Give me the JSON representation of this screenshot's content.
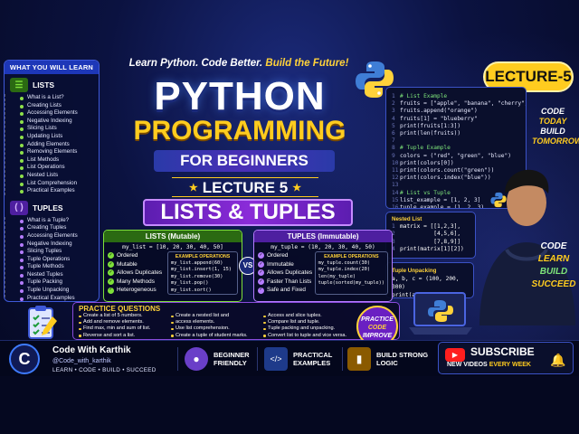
{
  "header": {
    "tagline_white": "Learn Python. Code Better. ",
    "tagline_yellow": "Build the Future!",
    "title_line1": "PYTHON",
    "title_line2": "PROGRAMMING",
    "subtitle": "FOR BEGINNERS",
    "lecture_line": "LECTURE 5",
    "topic": "LISTS & TUPLES",
    "lecture_badge": "LECTURE-5"
  },
  "sidebar": {
    "heading": "WHAT YOU WILL LEARN",
    "lists": {
      "title": "LISTS",
      "items": [
        "What is a List?",
        "Creating Lists",
        "Accessing Elements",
        "Negative Indexing",
        "Slicing Lists",
        "Updating Lists",
        "Adding Elements",
        "Removing Elements",
        "List Methods",
        "List Operations",
        "Nested Lists",
        "List Comprehension",
        "Practical Examples"
      ]
    },
    "tuples": {
      "title": "TUPLES",
      "items": [
        "What is a Tuple?",
        "Creating Tuples",
        "Accessing Elements",
        "Negative Indexing",
        "Slicing Tuples",
        "Tuple Operations",
        "Tuple Methods",
        "Nested Tuples",
        "Tuple Packing",
        "Tuple Unpacking",
        "Practical Examples"
      ]
    }
  },
  "code_main": [
    {
      "n": "1",
      "t": "# List Example",
      "c": "cmt"
    },
    {
      "n": "2",
      "t": "fruits = [\"apple\", \"banana\", \"cherry\"]",
      "c": ""
    },
    {
      "n": "3",
      "t": "fruits.append(\"orange\")",
      "c": ""
    },
    {
      "n": "4",
      "t": "fruits[1] = \"blueberry\"",
      "c": ""
    },
    {
      "n": "5",
      "t": "print(fruits[1:3])",
      "c": ""
    },
    {
      "n": "6",
      "t": "print(len(fruits))",
      "c": ""
    },
    {
      "n": "7",
      "t": "",
      "c": ""
    },
    {
      "n": "8",
      "t": "# Tuple Example",
      "c": "cmt"
    },
    {
      "n": "9",
      "t": "colors = (\"red\", \"green\", \"blue\")",
      "c": ""
    },
    {
      "n": "10",
      "t": "print(colors[0])",
      "c": ""
    },
    {
      "n": "11",
      "t": "print(colors.count(\"green\"))",
      "c": ""
    },
    {
      "n": "12",
      "t": "print(colors.index(\"blue\"))",
      "c": ""
    },
    {
      "n": "13",
      "t": "",
      "c": ""
    },
    {
      "n": "14",
      "t": "# List vs Tuple",
      "c": "cmt"
    },
    {
      "n": "15",
      "t": "list_example = [1, 2, 3]",
      "c": ""
    },
    {
      "n": "16",
      "t": "tuple_example = (1, 2, 3)",
      "c": ""
    }
  ],
  "code_nested": {
    "title": "Nested List",
    "lines": [
      {
        "n": "1",
        "t": "matrix = [[1,2,3],"
      },
      {
        "n": "2",
        "t": "          [4,5,6],"
      },
      {
        "n": "3",
        "t": "          [7,8,9]]"
      },
      {
        "n": "4",
        "t": "print(matrix[1][2])"
      }
    ]
  },
  "code_unpack": {
    "title": "Tuple Unpacking",
    "lines": [
      "a, b, c = (100, 200, 300)",
      "print(a, b, c)"
    ]
  },
  "motto": [
    "CODE",
    "TODAY",
    "BUILD",
    "TOMORROW"
  ],
  "side_motto": [
    "CODE",
    "LEARN",
    "BUILD",
    "SUCCEED"
  ],
  "lists_panel": {
    "title": "LISTS (Mutable)",
    "code": "my_list = [10, 20, 30, 40, 50]",
    "features": [
      "Ordered",
      "Mutable",
      "Allows Duplicates",
      "Many Methods",
      "Heterogeneous"
    ],
    "ops_title": "EXAMPLE OPERATIONS",
    "ops": [
      "my_list.append(60)",
      "my_list.insert(1, 15)",
      "my_list.remove(30)",
      "my_list.pop()",
      "my_list.sort()"
    ]
  },
  "vs": "VS",
  "tuples_panel": {
    "title": "TUPLES (Immutable)",
    "code": "my_tuple = (10, 20, 30, 40, 50)",
    "features": [
      "Ordered",
      "Immutable",
      "Allows Duplicates",
      "Faster Than Lists",
      "Safe and Fixed"
    ],
    "ops_title": "EXAMPLE OPERATIONS",
    "ops": [
      "my_tuple.count(30)",
      "my_tuple.index(20)",
      "len(my_tuple)",
      "tuple(sorted(my_tuple))"
    ]
  },
  "practice": {
    "title": "PRACTICE QUESTIONS",
    "col1": [
      "Create a list of 5 numbers.",
      "Add and remove elements.",
      "Find max, min and sum of list.",
      "Reverse and sort a list."
    ],
    "col2": [
      "Create a nested list and",
      "access elements.",
      "Use list comprehension.",
      "Create a tuple of student marks."
    ],
    "col3": [
      "Access and slice tuples.",
      "Compare list and tuple.",
      "Tuple packing and unpacking.",
      "Convert list to tuple and vice versa."
    ],
    "badge": [
      "PRACTICE",
      "CODE",
      "IMPROVE"
    ]
  },
  "footer": {
    "brand": "Code With Karthik",
    "handle": "@Code_with_karthik",
    "tagline": "LEARN  •  CODE  •  BUILD  •  SUCCEED",
    "feat1": [
      "BEGINNER",
      "FRIENDLY"
    ],
    "feat2": [
      "PRACTICAL",
      "EXAMPLES"
    ],
    "feat3": [
      "BUILD STRONG",
      "LOGIC"
    ],
    "subscribe": "SUBSCRIBE",
    "new_videos": "NEW VIDEOS ",
    "every_week": "EVERY WEEK"
  },
  "colors": {
    "accent_yellow": "#ffcc1f",
    "list_green": "#7ee03a",
    "tuple_purple": "#b57cff",
    "brand_blue": "#1d37b8"
  }
}
